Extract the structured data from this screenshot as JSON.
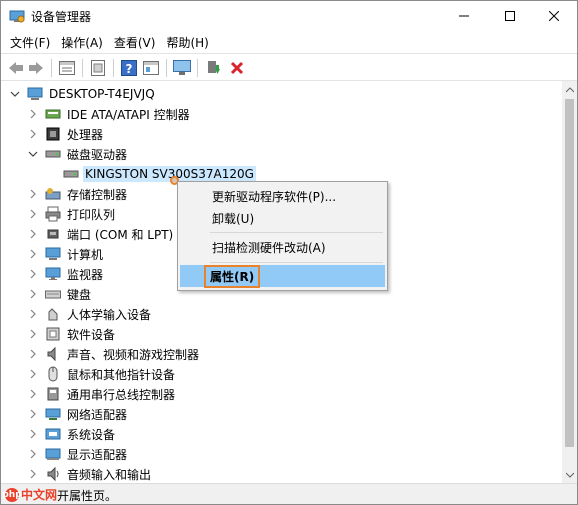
{
  "window": {
    "title": "设备管理器"
  },
  "menubar": [
    {
      "name": "menu-file",
      "label": "文件(F)"
    },
    {
      "name": "menu-action",
      "label": "操作(A)"
    },
    {
      "name": "menu-view",
      "label": "查看(V)"
    },
    {
      "name": "menu-help",
      "label": "帮助(H)"
    }
  ],
  "toolbar": {
    "icons": [
      "back-arrow-icon",
      "forward-arrow-icon",
      "properties-sheet-icon",
      "device-list-icon",
      "help-icon",
      "update-driver-icon",
      "scan-monitor-icon",
      "enable-device-icon",
      "uninstall-x-icon"
    ]
  },
  "tree": {
    "root": "DESKTOP-T4EJVJQ",
    "items": [
      {
        "name": "ide-ata",
        "label": "IDE ATA/ATAPI 控制器",
        "icon": "ide-controller-icon",
        "expanded": false
      },
      {
        "name": "processors",
        "label": "处理器",
        "icon": "processor-icon",
        "expanded": false
      },
      {
        "name": "disk-drives",
        "label": "磁盘驱动器",
        "icon": "disk-drive-icon",
        "expanded": true
      },
      {
        "name": "kingston",
        "label": "KINGSTON SV300S37A120G",
        "icon": "disk-drive-icon",
        "child": true,
        "selected": true
      },
      {
        "name": "storage-controllers",
        "label": "存储控制器",
        "icon": "storage-controller-icon",
        "expanded": false
      },
      {
        "name": "print-queues",
        "label": "打印队列",
        "icon": "printer-icon",
        "expanded": false
      },
      {
        "name": "ports",
        "label": "端口 (COM 和 LPT)",
        "icon": "port-icon",
        "expanded": false
      },
      {
        "name": "computer",
        "label": "计算机",
        "icon": "computer-icon",
        "expanded": false
      },
      {
        "name": "monitors",
        "label": "监视器",
        "icon": "monitor-icon",
        "expanded": false
      },
      {
        "name": "keyboards",
        "label": "键盘",
        "icon": "keyboard-icon",
        "expanded": false
      },
      {
        "name": "hid",
        "label": "人体学输入设备",
        "icon": "hid-icon",
        "expanded": false
      },
      {
        "name": "software-devices",
        "label": "软件设备",
        "icon": "software-device-icon",
        "expanded": false
      },
      {
        "name": "audio-video",
        "label": "声音、视频和游戏控制器",
        "icon": "speaker-icon",
        "expanded": false
      },
      {
        "name": "mice",
        "label": "鼠标和其他指针设备",
        "icon": "mouse-icon",
        "expanded": false
      },
      {
        "name": "usb",
        "label": "通用串行总线控制器",
        "icon": "usb-icon",
        "expanded": false
      },
      {
        "name": "network",
        "label": "网络适配器",
        "icon": "network-adapter-icon",
        "expanded": false
      },
      {
        "name": "system-devices",
        "label": "系统设备",
        "icon": "system-device-icon",
        "expanded": false
      },
      {
        "name": "display-adapters",
        "label": "显示适配器",
        "icon": "display-adapter-icon",
        "expanded": false
      },
      {
        "name": "audio-io",
        "label": "音频输入和输出",
        "icon": "audio-io-icon",
        "expanded": false
      }
    ]
  },
  "context_menu": {
    "items": [
      {
        "name": "update-driver",
        "label": "更新驱动程序软件(P)..."
      },
      {
        "name": "uninstall",
        "label": "卸载(U)"
      },
      {
        "name": "scan-hardware",
        "label": "扫描检测硬件改动(A)"
      },
      {
        "name": "properties",
        "label": "属性(R)",
        "highlighted": true
      }
    ]
  },
  "statusbar": {
    "text": "开属性页。",
    "watermark": "中文网",
    "watermark_badge": "php"
  },
  "colors": {
    "selection": "#cce8ff",
    "menu_highlight": "#91c9f7",
    "annotation_orange": "#e8822c"
  }
}
